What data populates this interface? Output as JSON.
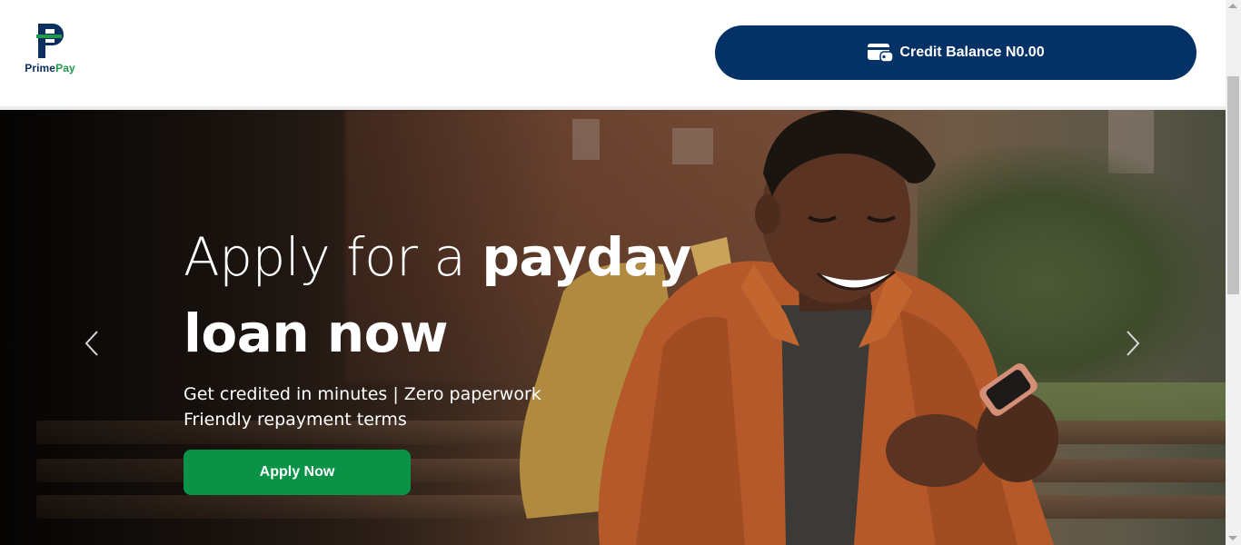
{
  "header": {
    "logo": {
      "brand_primary": "Prime",
      "brand_secondary": "Pay",
      "icon": "primepay-logo-icon"
    },
    "credit_balance": {
      "icon": "wallet-icon",
      "label": "Credit Balance N0.00"
    }
  },
  "hero": {
    "title_light": "Apply for a",
    "title_bold_1": "payday",
    "title_bold_2": "loan now",
    "subtitle_line_1": "Get credited in minutes | Zero paperwork",
    "subtitle_line_2": "Friendly repayment terms",
    "cta_label": "Apply Now",
    "prev_icon": "chevron-left-icon",
    "next_icon": "chevron-right-icon"
  },
  "colors": {
    "navy": "#053266",
    "green": "#0a9347",
    "logo_green": "#1f9a4d"
  }
}
